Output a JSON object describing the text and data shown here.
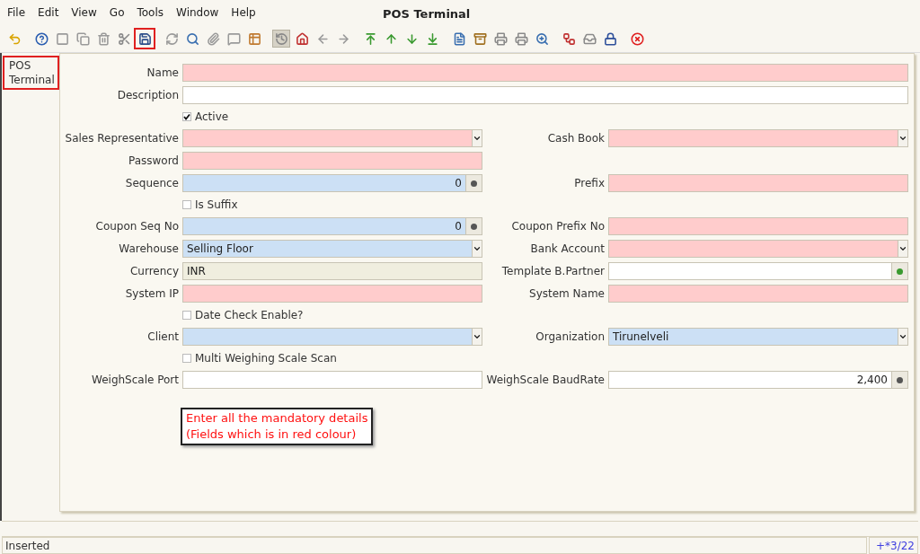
{
  "menu": [
    "File",
    "Edit",
    "View",
    "Go",
    "Tools",
    "Window",
    "Help"
  ],
  "window": {
    "title": "POS Terminal"
  },
  "toolbar": [
    {
      "kind": "undo",
      "selected": false
    },
    {
      "kind": "help",
      "selected": false
    },
    {
      "kind": "new",
      "selected": false
    },
    {
      "kind": "copy",
      "selected": false
    },
    {
      "kind": "delete",
      "selected": false
    },
    {
      "kind": "delete-selection",
      "selected": false
    },
    {
      "kind": "save",
      "selected": false
    },
    {
      "kind": "refresh",
      "selected": false
    },
    {
      "kind": "find",
      "selected": false
    },
    {
      "kind": "attachment",
      "selected": false
    },
    {
      "kind": "chat",
      "selected": false
    },
    {
      "kind": "grid",
      "selected": false
    },
    {
      "kind": "history",
      "selected": true
    },
    {
      "kind": "home",
      "selected": false
    },
    {
      "kind": "previous",
      "selected": false
    },
    {
      "kind": "next",
      "selected": false
    },
    {
      "kind": "first",
      "selected": false
    },
    {
      "kind": "up",
      "selected": false
    },
    {
      "kind": "down",
      "selected": false
    },
    {
      "kind": "last",
      "selected": false
    },
    {
      "kind": "report",
      "selected": false
    },
    {
      "kind": "archive",
      "selected": false
    },
    {
      "kind": "print-preview",
      "selected": false
    },
    {
      "kind": "print",
      "selected": false
    },
    {
      "kind": "zoom-across",
      "selected": false
    },
    {
      "kind": "workflow",
      "selected": false
    },
    {
      "kind": "request",
      "selected": false
    },
    {
      "kind": "lock",
      "selected": false
    },
    {
      "kind": "close",
      "selected": false
    }
  ],
  "sidebar": {
    "items": [
      {
        "label": "POS Terminal",
        "selected": true
      }
    ]
  },
  "rows": [
    {
      "left": {
        "kind": "text",
        "label": "Name",
        "color": "#ffcccc"
      },
      "full": true
    },
    {
      "left": {
        "kind": "text",
        "label": "Description",
        "color": "#ffffff"
      },
      "full": true
    },
    {
      "left": {
        "kind": "checkbox",
        "label": "Active",
        "checked": true
      }
    },
    {
      "left": {
        "kind": "combo",
        "label": "Sales Representative",
        "color": "#ffcccc"
      },
      "right": {
        "kind": "combo",
        "label": "Cash Book",
        "color": "#ffcccc"
      }
    },
    {
      "left": {
        "kind": "text",
        "label": "Password",
        "color": "#ffcccc"
      }
    },
    {
      "left": {
        "kind": "number",
        "label": "Sequence",
        "color": "#cce0f5",
        "value": "0"
      },
      "right": {
        "kind": "text",
        "label": "Prefix",
        "color": "#ffcccc"
      }
    },
    {
      "left": {
        "kind": "checkbox",
        "label": "Is Suffix",
        "checked": false
      }
    },
    {
      "left": {
        "kind": "number",
        "label": "Coupon Seq No",
        "color": "#cce0f5",
        "value": "0"
      },
      "right": {
        "kind": "text",
        "label": "Coupon Prefix No",
        "color": "#ffcccc"
      }
    },
    {
      "left": {
        "kind": "combo",
        "label": "Warehouse",
        "color": "#cce0f5",
        "value": "Selling Floor"
      },
      "right": {
        "kind": "combo",
        "label": "Bank Account",
        "color": "#ffcccc"
      }
    },
    {
      "left": {
        "kind": "text",
        "label": "Currency",
        "color": "#f0eedf",
        "value": "INR"
      },
      "right": {
        "kind": "search",
        "label": "Template B.Partner",
        "color": "#ffffff"
      }
    },
    {
      "left": {
        "kind": "text",
        "label": "System IP",
        "color": "#ffcccc"
      },
      "right": {
        "kind": "text",
        "label": "System Name",
        "color": "#ffcccc"
      }
    },
    {
      "left": {
        "kind": "checkbox",
        "label": "Date Check Enable?",
        "checked": false
      }
    },
    {
      "left": {
        "kind": "combo",
        "label": "Client",
        "color": "#cce0f5"
      },
      "right": {
        "kind": "combo",
        "label": "Organization",
        "color": "#cce0f5",
        "value": "Tirunelveli"
      }
    },
    {
      "left": {
        "kind": "checkbox",
        "label": "Multi Weighing Scale Scan",
        "checked": false
      }
    },
    {
      "left": {
        "kind": "text",
        "label": "WeighScale Port",
        "color": "#ffffff"
      },
      "right": {
        "kind": "number",
        "label": "WeighScale BaudRate",
        "color": "#ffffff",
        "value": "2,400"
      }
    }
  ],
  "callout": "Enter all the mandatory details\n (Fields which is in red colour)",
  "status_bar": {
    "message": "Inserted",
    "record": "+*3/22"
  }
}
